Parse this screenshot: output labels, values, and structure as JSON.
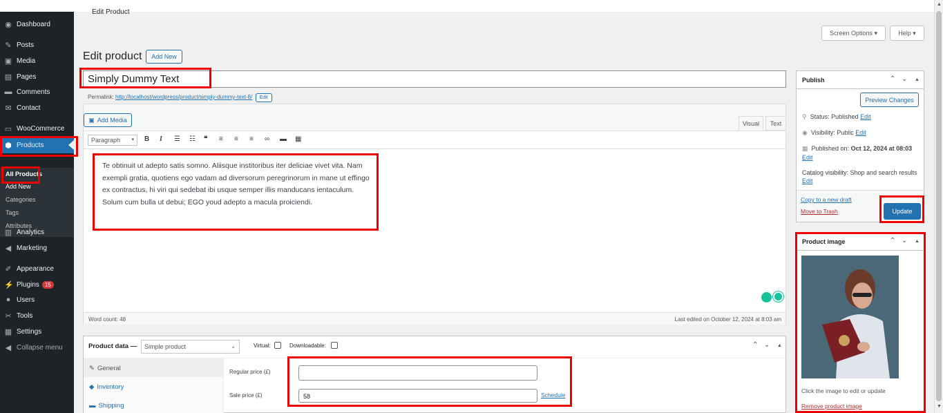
{
  "adminbar": {
    "title": "Edit Product"
  },
  "menu": {
    "items": [
      {
        "label": "Dashboard",
        "icon": "dashboard-icon",
        "glyph": "◉"
      },
      {
        "label": "Posts",
        "icon": "pin-icon",
        "glyph": "✎"
      },
      {
        "label": "Media",
        "icon": "media-icon",
        "glyph": "▣"
      },
      {
        "label": "Pages",
        "icon": "pages-icon",
        "glyph": "▤"
      },
      {
        "label": "Comments",
        "icon": "comments-icon",
        "glyph": "▬"
      },
      {
        "label": "Contact",
        "icon": "mail-icon",
        "glyph": "✉"
      },
      {
        "label": "WooCommerce",
        "icon": "woocommerce-icon",
        "glyph": "▭"
      },
      {
        "label": "Products",
        "icon": "products-icon",
        "glyph": "⬢"
      },
      {
        "label": "Analytics",
        "icon": "analytics-icon",
        "glyph": "▥"
      },
      {
        "label": "Marketing",
        "icon": "megaphone-icon",
        "glyph": "◀"
      },
      {
        "label": "Appearance",
        "icon": "brush-icon",
        "glyph": "✐"
      },
      {
        "label": "Plugins",
        "icon": "plugin-icon",
        "glyph": "⚡",
        "badge": "15"
      },
      {
        "label": "Users",
        "icon": "users-icon",
        "glyph": "●"
      },
      {
        "label": "Tools",
        "icon": "wrench-icon",
        "glyph": "✂"
      },
      {
        "label": "Settings",
        "icon": "settings-icon",
        "glyph": "▦"
      },
      {
        "label": "Collapse menu",
        "icon": "collapse-icon",
        "glyph": "◀"
      }
    ],
    "submenu": [
      "All Products",
      "Add New",
      "Categories",
      "Tags",
      "Attributes"
    ]
  },
  "screen_options": "Screen Options ▾",
  "help": "Help ▾",
  "heading": "Edit product",
  "add_new": "Add New",
  "title_value": "Simply Dummy Text",
  "permalink": {
    "label": "Permalink:",
    "url": "http://localhost/wordpress/product/simply-dummy-text-8/",
    "edit": "Edit"
  },
  "editor": {
    "add_media": "Add Media",
    "tab_visual": "Visual",
    "tab_text": "Text",
    "format": "Paragraph",
    "content": "Te obtinuit ut adepto satis somno. Aliisque institoribus iter deliciae vivet vita. Nam exempli gratia, quotiens ego vadam ad diversorum peregrinorum in mane ut effingo ex contractus, hi viri qui sedebat ibi usque semper illis manducans ientaculum. Solum cum bulla ut debui; EGO youd adepto a macula proiciendi.",
    "word_count": "Word count: 48",
    "last_edited": "Last edited on October 12, 2024 at 8:03 am"
  },
  "publish": {
    "title": "Publish",
    "preview": "Preview Changes",
    "status_label": "Status:",
    "status": "Published",
    "visibility_label": "Visibility:",
    "visibility": "Public",
    "published_label": "Published on:",
    "published_on": "Oct 12, 2024 at 08:03",
    "catalog_label": "Catalog visibility:",
    "catalog": "Shop and search results",
    "edit": "Edit",
    "copy_draft": "Copy to a new draft",
    "trash": "Move to Trash",
    "update": "Update"
  },
  "product_image": {
    "title": "Product image",
    "hint": "Click the image to edit or update",
    "remove": "Remove product image"
  },
  "product_data": {
    "label": "Product data —",
    "type": "Simple product",
    "virtual": "Virtual:",
    "downloadable": "Downloadable:",
    "tabs": [
      "General",
      "Inventory",
      "Shipping"
    ],
    "regular_price_label": "Regular price (£)",
    "regular_price": "",
    "sale_price_label": "Sale price (£)",
    "sale_price": "58",
    "schedule": "Schedule"
  },
  "colors": {
    "accent": "#2271b1",
    "highlight": "#e00000",
    "menu_bg": "#1d2327"
  }
}
